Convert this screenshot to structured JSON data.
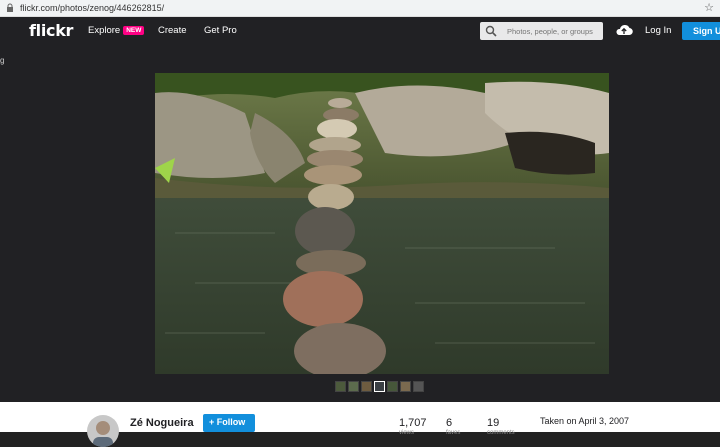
{
  "browser": {
    "url": "flickr.com/photos/zenog/446262815/"
  },
  "nav": {
    "logo": "flickr",
    "explore": "Explore",
    "explore_badge": "NEW",
    "create": "Create",
    "get_pro": "Get Pro",
    "search_placeholder": "Photos, people, or groups",
    "login": "Log In",
    "signup": "Sign Up"
  },
  "stage": {
    "back_glyph": "g"
  },
  "info": {
    "owner": "Zé Nogueira",
    "follow": "+ Follow",
    "stats": [
      {
        "value": "1,707",
        "label": "views"
      },
      {
        "value": "6",
        "label": "faves"
      },
      {
        "value": "19",
        "label": "comments"
      }
    ],
    "taken": "Taken on April 3, 2007"
  },
  "colors": {
    "accent": "#128fdc",
    "badge": "#ff0084",
    "chrome": "#212124"
  }
}
